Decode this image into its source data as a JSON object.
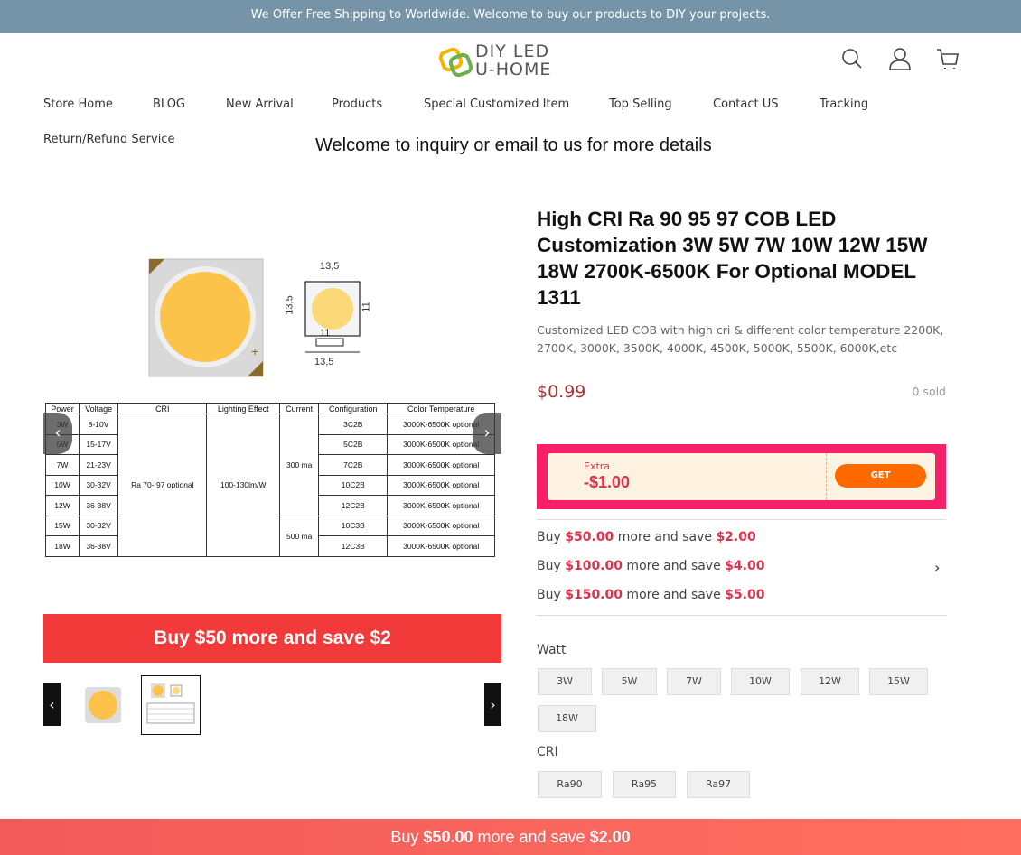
{
  "announcement": "We Offer Free Shipping to Worldwide. Welcome to buy our products to DIY your projects.",
  "logo": {
    "line1": "DIY LED",
    "line2": "U-HOME"
  },
  "nav": [
    "Store Home",
    "BLOG",
    "New Arrival",
    "Products",
    "Special Customized Item",
    "Top Selling",
    "Contact US",
    "Tracking",
    "Return/Refund Service"
  ],
  "welcome": "Welcome to inquiry or email to us for more details",
  "gallery": {
    "dim_top": "13,5",
    "dim_side": "13,5",
    "dim_right": "11",
    "dim_mid": "11",
    "dim_bottom": "13,5",
    "table_headers": [
      "Power",
      "Voltage",
      "CRI",
      "Lighting Effect",
      "Current",
      "Configuration",
      "Color Temperature"
    ],
    "table_rows": [
      {
        "power": "3W",
        "voltage": "8-10V",
        "config": "3C2B",
        "color": "3000K-6500K optional"
      },
      {
        "power": "5W",
        "voltage": "15-17V",
        "config": "5C2B",
        "color": "3000K-6500K optional"
      },
      {
        "power": "7W",
        "voltage": "21-23V",
        "config": "7C2B",
        "color": "3000K-6500K optional"
      },
      {
        "power": "10W",
        "voltage": "30-32V",
        "config": "10C2B",
        "color": "3000K-6500K optional"
      },
      {
        "power": "12W",
        "voltage": "36-38V",
        "config": "12C2B",
        "color": "3000K-6500K optional"
      },
      {
        "power": "15W",
        "voltage": "30-32V",
        "config": "10C3B",
        "color": "3000K-6500K optional"
      },
      {
        "power": "18W",
        "voltage": "36-38V",
        "config": "12C3B",
        "color": "3000K-6500K optional"
      }
    ],
    "cri": "Ra 70- 97 optional",
    "lighting_effect": "100-130lm/W",
    "current_1": "300 ma",
    "current_2": "500 ma"
  },
  "promo_banner": "Buy $50 more and save $2",
  "product": {
    "title": "High CRI Ra 90 95 97 COB LED Customization 3W 5W 7W 10W 12W 15W 18W 2700K-6500K For Optional MODEL 1311",
    "subtitle": "Customized LED COB with high cri & different color temperature 2200K, 2700K, 3000K, 3500K, 4000K, 4500K, 5000K, 5500K, 6000K,etc",
    "price": "$0.99",
    "sold": "0 sold"
  },
  "coupon": {
    "extra": "Extra",
    "amount": "-$1.00",
    "get": "GET"
  },
  "discounts": [
    {
      "pre": "Buy ",
      "amount": "$50.00",
      "mid": " more and save ",
      "save": "$2.00"
    },
    {
      "pre": "Buy ",
      "amount": "$100.00",
      "mid": " more and save ",
      "save": "$4.00"
    },
    {
      "pre": "Buy ",
      "amount": "$150.00",
      "mid": " more and save ",
      "save": "$5.00"
    }
  ],
  "watt": {
    "label": "Watt",
    "options": [
      "3W",
      "5W",
      "7W",
      "10W",
      "12W",
      "15W",
      "18W"
    ]
  },
  "cri": {
    "label": "CRI",
    "options": [
      "Ra90",
      "Ra95",
      "Ra97"
    ]
  },
  "bottom_bar": {
    "pre": "Buy ",
    "amount": "$50.00",
    "mid": " more and save ",
    "save": "$2.00"
  },
  "colors": {
    "announcement_bg": "#7594a7",
    "promo_red": "#f23a3a",
    "coupon_pink": "#f71e6a",
    "get_orange": "#ff6a00"
  },
  "icons": [
    "search-icon",
    "user-icon",
    "cart-icon",
    "chevron-left-icon",
    "chevron-right-icon"
  ]
}
